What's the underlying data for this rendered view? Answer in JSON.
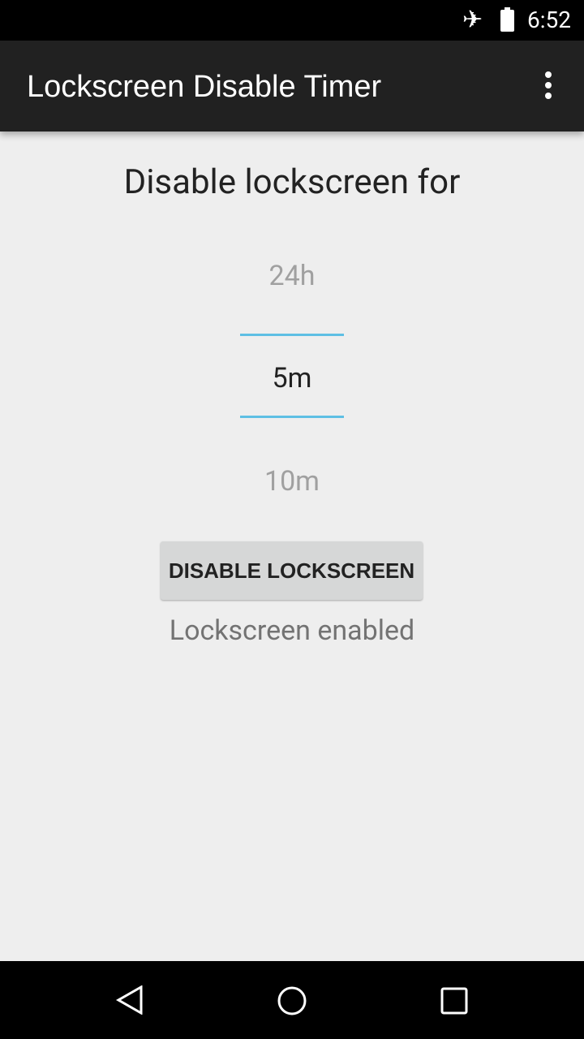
{
  "status_bar": {
    "time": "6:52",
    "icons": [
      "airplane-icon",
      "battery-icon"
    ]
  },
  "app_bar": {
    "title": "Lockscreen Disable Timer",
    "menu_icon": "overflow-menu-icon"
  },
  "main": {
    "heading": "Disable lockscreen for",
    "picker": {
      "previous": "24h",
      "selected": "5m",
      "next": "10m"
    },
    "button_label": "DISABLE LOCKSCREEN",
    "status": "Lockscreen enabled"
  },
  "colors": {
    "accent": "#5ebfe4",
    "appbar": "#212121"
  },
  "nav_bar": {
    "icons": [
      "back-icon",
      "home-icon",
      "recents-icon"
    ]
  }
}
